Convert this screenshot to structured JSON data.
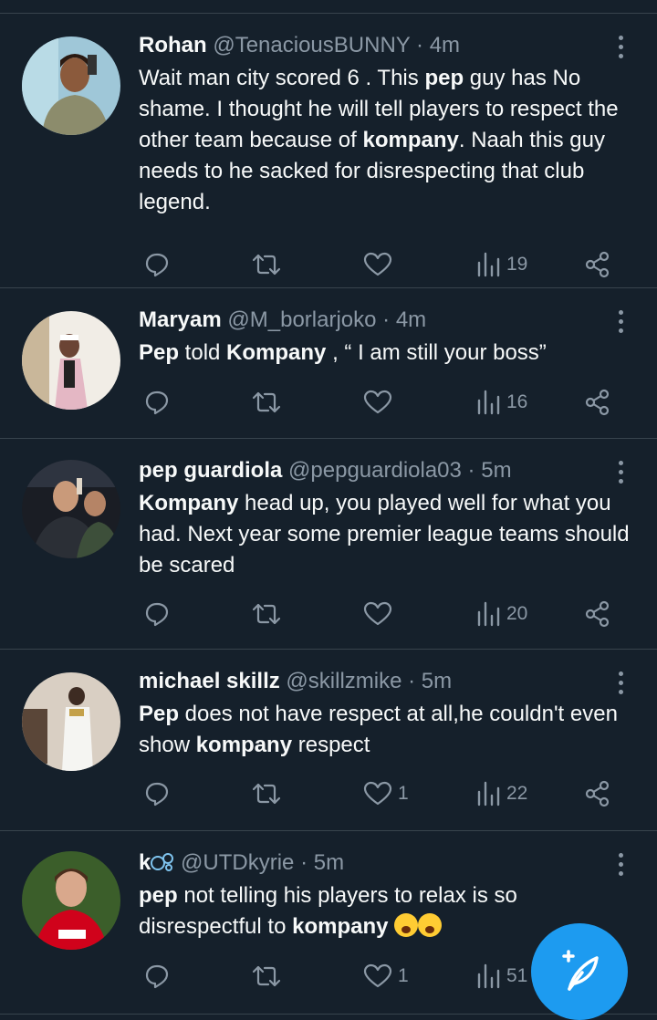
{
  "colors": {
    "background": "#15202b",
    "divider": "#38444d",
    "text": "#f7f9f9",
    "muted": "#8b98a5",
    "accent": "#1d9bf0"
  },
  "tweets": [
    {
      "name": "Rohan",
      "handle": "@TenaciousBUNNY",
      "sep": "·",
      "time": "4m",
      "text": [
        {
          "t": "Wait man city scored 6 . This "
        },
        {
          "t": "pep",
          "b": true
        },
        {
          "t": " guy has No shame. I thought he will tell players to respect the other team because of "
        },
        {
          "t": "kompany",
          "b": true
        },
        {
          "t": ". Naah this guy needs to he sacked for disrespecting that club legend."
        }
      ],
      "likes": "",
      "views": "19"
    },
    {
      "name": "Maryam",
      "handle": "@M_borlarjoko",
      "sep": "·",
      "time": "4m",
      "text": [
        {
          "t": "Pep",
          "b": true
        },
        {
          "t": " told "
        },
        {
          "t": "Kompany",
          "b": true
        },
        {
          "t": " , “ I am still your boss”"
        }
      ],
      "likes": "",
      "views": "16"
    },
    {
      "name": "pep guardiola",
      "handle": "@pepguardiola03",
      "sep": "·",
      "time": "5m",
      "text": [
        {
          "t": "Kompany",
          "b": true
        },
        {
          "t": " head up, you played well for what you had. Next year some premier league teams should be scared"
        }
      ],
      "likes": "",
      "views": "20"
    },
    {
      "name": "michael skillz",
      "handle": "@skillzmike",
      "sep": "·",
      "time": "5m",
      "text": [
        {
          "t": "Pep",
          "b": true
        },
        {
          "t": " does not have respect at all,he couldn't even show "
        },
        {
          "t": "kompany",
          "b": true
        },
        {
          "t": " respect"
        }
      ],
      "likes": "1",
      "views": "22"
    },
    {
      "name": "k",
      "handle": "@UTDkyrie",
      "sep": "·",
      "time": "5m",
      "text": [
        {
          "t": "pep",
          "b": true
        },
        {
          "t": " not telling his players to relax is so disrespectful to "
        },
        {
          "t": "kompany",
          "b": true
        },
        {
          "t": " "
        }
      ],
      "likes": "1",
      "views": "51"
    }
  ],
  "icons": {
    "reply": "reply-icon",
    "retweet": "retweet-icon",
    "like": "heart-icon",
    "views": "views-icon",
    "share": "share-icon",
    "more": "more-icon",
    "compose": "compose-icon"
  }
}
